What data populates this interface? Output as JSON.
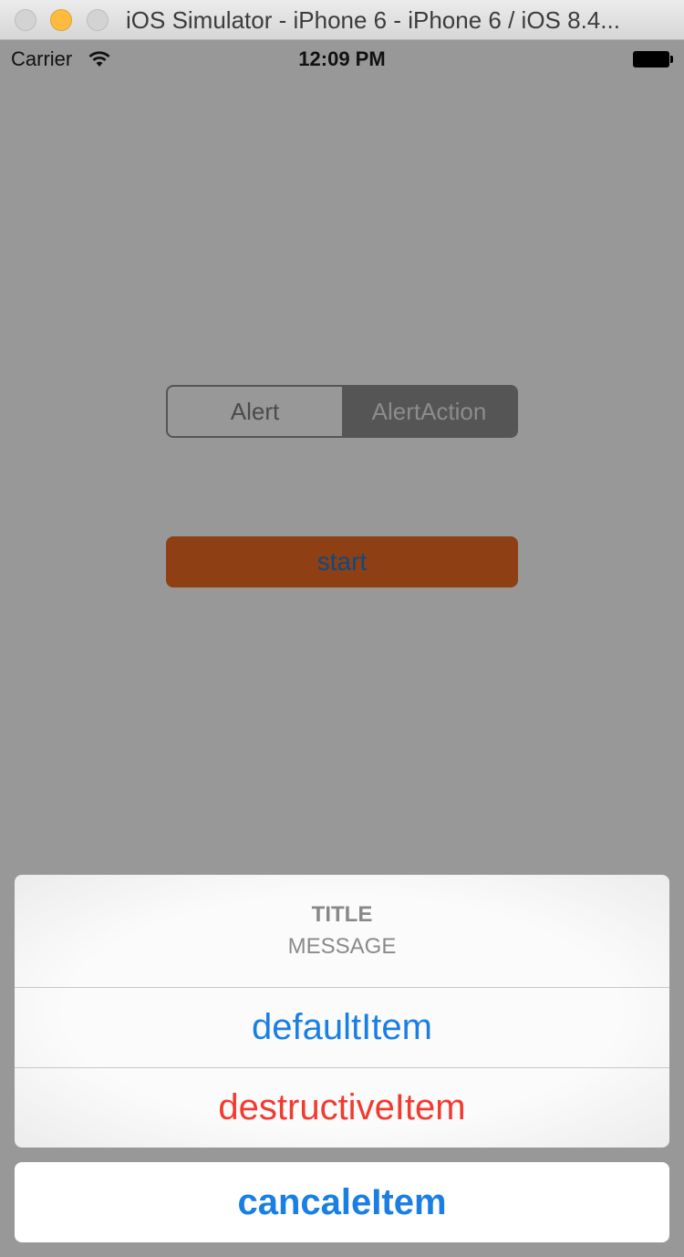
{
  "window": {
    "title": "iOS Simulator - iPhone 6 - iPhone 6 / iOS 8.4..."
  },
  "statusbar": {
    "carrier": "Carrier",
    "time": "12:09 PM"
  },
  "segmented": {
    "items": [
      "Alert",
      "AlertAction"
    ],
    "selected_index": 1
  },
  "start_button": {
    "label": "start"
  },
  "action_sheet": {
    "title": "TITLE",
    "message": "MESSAGE",
    "actions": [
      "defaultItem",
      "destructiveItem"
    ],
    "cancel": "cancaleItem"
  },
  "colors": {
    "ios_blue": "#1a7fe3",
    "destructive_red": "#f23a2e",
    "start_button_bg": "#8e4014"
  },
  "icons": [
    "wifi-icon",
    "battery-icon"
  ]
}
